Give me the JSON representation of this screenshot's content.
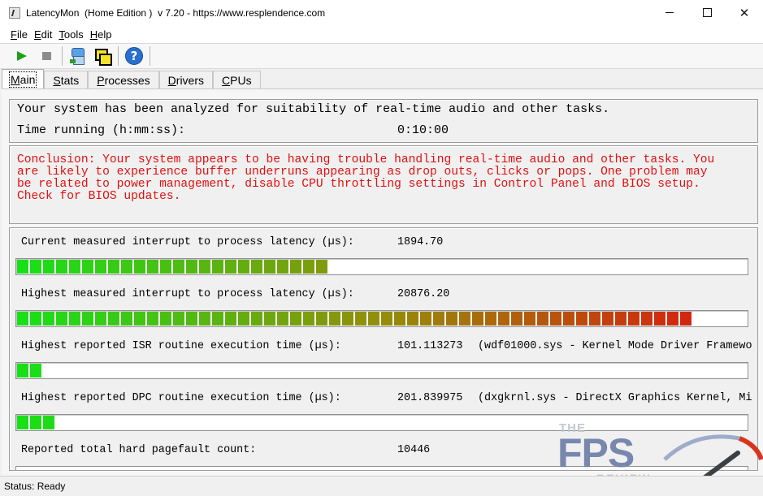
{
  "window": {
    "title": "LatencyMon  (Home Edition )  v 7.20 - https://www.resplendence.com",
    "icon": "latencymon-app-icon",
    "controls": {
      "minimize": "minimize",
      "maximize": "maximize",
      "close": "✕"
    }
  },
  "menu": [
    {
      "key": "F",
      "rest": "ile"
    },
    {
      "key": "E",
      "rest": "dit"
    },
    {
      "key": "T",
      "rest": "ools"
    },
    {
      "key": "H",
      "rest": "elp"
    }
  ],
  "toolbar": [
    "play-icon",
    "stop-icon",
    "cleaner-icon",
    "windows-icon",
    "help-icon"
  ],
  "tabs": [
    {
      "key": "M",
      "rest": "ain",
      "active": true
    },
    {
      "key": "S",
      "rest": "tats",
      "active": false
    },
    {
      "key": "P",
      "rest": "rocesses",
      "active": false
    },
    {
      "key": "D",
      "rest": "rivers",
      "active": false
    },
    {
      "key": "C",
      "rest": "PUs",
      "active": false
    }
  ],
  "summary": {
    "analyzed": "Your system has been analyzed for suitability of real-time audio and other tasks.",
    "time_label": "Time running (h:mm:ss):",
    "time_value": "0:10:00"
  },
  "conclusion": [
    "Conclusion: Your system appears to be having trouble handling real-time audio and other tasks. You",
    "are likely to experience buffer underruns appearing as drop outs, clicks or pops. One problem may",
    "be related to power management, disable CPU throttling settings in Control Panel and BIOS setup.",
    "Check for BIOS updates."
  ],
  "metrics": [
    {
      "label": "Current measured interrupt to process latency (µs):",
      "value": "1894.70",
      "extra": "",
      "level": 0.424
    },
    {
      "label": "Highest measured interrupt to process latency (µs):",
      "value": "20876.20",
      "extra": "",
      "level": 0.922
    },
    {
      "label": "Highest reported ISR routine execution time (µs):",
      "value": "101.113273",
      "extra": "(wdf01000.sys - Kernel Mode Driver Framewo",
      "level": 0.034
    },
    {
      "label": "Highest reported DPC routine execution time (µs):",
      "value": "201.839975",
      "extra": "(dxgkrnl.sys - DirectX Graphics Kernel, Mi",
      "level": 0.052
    }
  ],
  "pagefault": {
    "label": "Reported total hard pagefault count:",
    "value": "10446"
  },
  "status": "Status: Ready",
  "watermark": {
    "the": "THE",
    "fps": "FPS",
    "review": "REVIEW"
  },
  "colors": {
    "conclusion_text": "#e01010",
    "bar_start": "#18e018",
    "bar_end": "#e01010"
  }
}
